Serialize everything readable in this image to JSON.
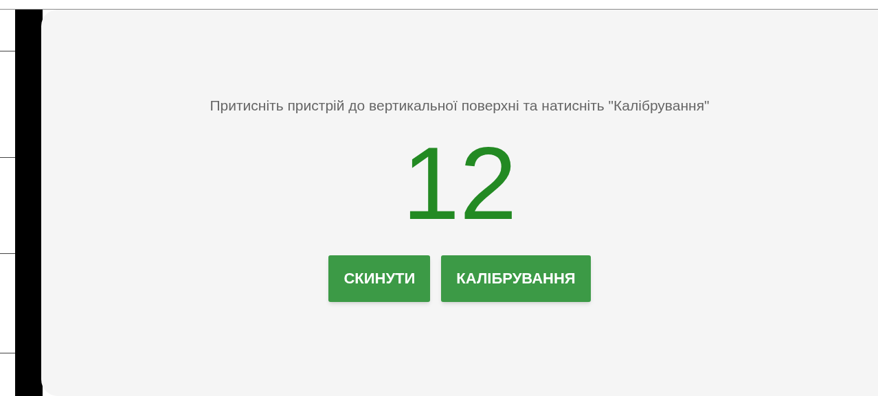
{
  "instruction": "Притисніть пристрій до вертикальної поверхні та натисніть \"Калібрування\"",
  "reading": "12",
  "buttons": [
    {
      "label": "СКИНУТИ"
    },
    {
      "label": "КАЛІБРУВАННЯ"
    }
  ]
}
